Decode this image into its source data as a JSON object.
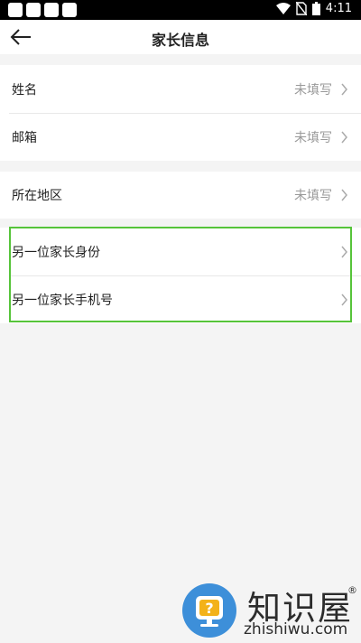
{
  "status_bar": {
    "time": "4:11",
    "icons": [
      "wifi-icon",
      "no-sim-icon",
      "battery-icon"
    ]
  },
  "header": {
    "title": "家长信息",
    "back_icon": "arrow-left-icon"
  },
  "sections": {
    "basic": [
      {
        "label": "姓名",
        "value": "未填写"
      },
      {
        "label": "邮箱",
        "value": "未填写"
      }
    ],
    "region": [
      {
        "label": "所在地区",
        "value": "未填写"
      }
    ],
    "other_parent": [
      {
        "label": "另一位家长身份"
      },
      {
        "label": "另一位家长手机号"
      }
    ]
  },
  "highlight_color": "#56c43a",
  "watermark": {
    "brand": "知识屋",
    "registered": "®",
    "domain": "zhishiwu.com"
  }
}
